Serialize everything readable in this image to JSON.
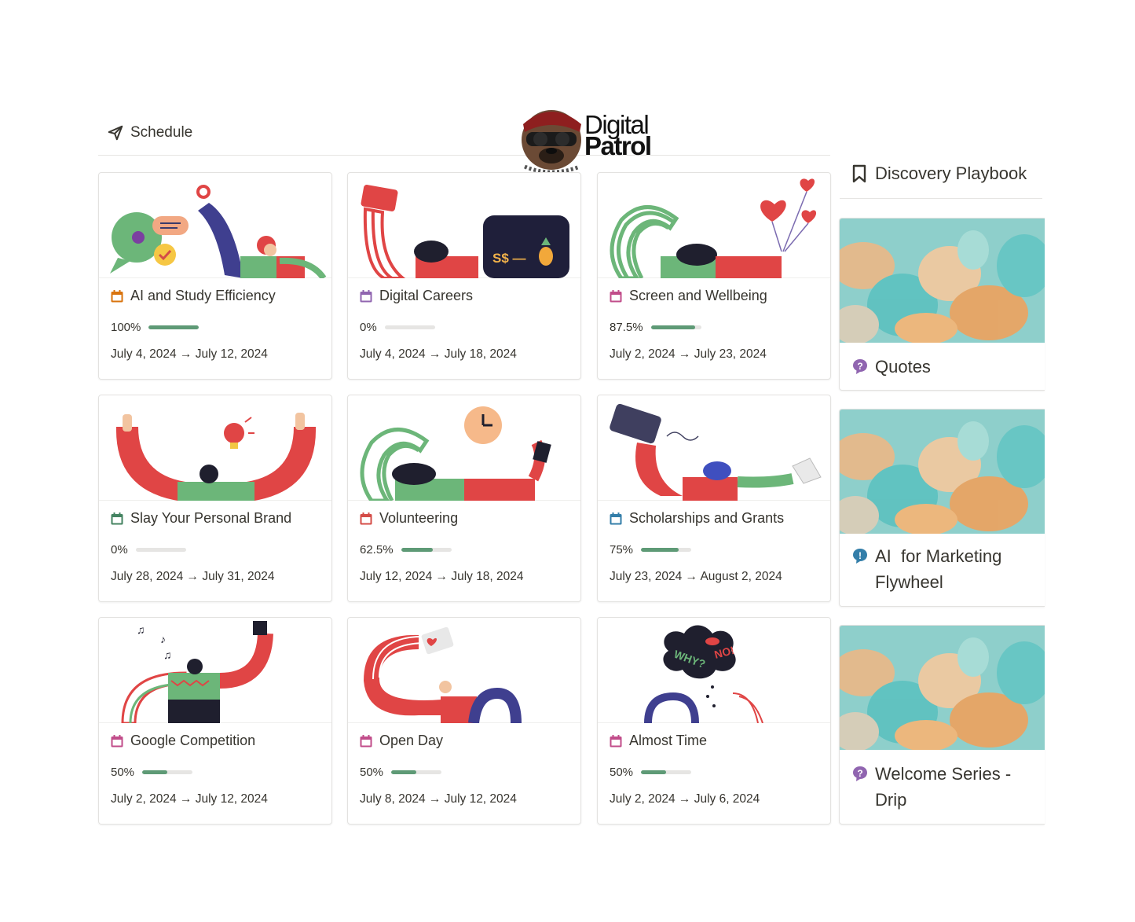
{
  "schedule": {
    "title": "Schedule"
  },
  "logo": {
    "line1": "Digital",
    "line2": "Patrol"
  },
  "cards": [
    {
      "title": "AI and Study Efficiency",
      "icon_color": "#d9730d",
      "progress_label": "100%",
      "progress": 1.0,
      "dates": "July 4, 2024 → July 12, 2024"
    },
    {
      "title": "Digital Careers",
      "icon_color": "#9065b0",
      "progress_label": "0%",
      "progress": 0.0,
      "dates": "July 4, 2024 → July 18, 2024"
    },
    {
      "title": "Screen and Wellbeing",
      "icon_color": "#c14c8a",
      "progress_label": "87.5%",
      "progress": 0.875,
      "dates": "July 2, 2024 → July 23, 2024"
    },
    {
      "title": "Slay Your Personal Brand",
      "icon_color": "#448361",
      "progress_label": "0%",
      "progress": 0.0,
      "dates": "July 28, 2024 → July 31, 2024"
    },
    {
      "title": "Volunteering",
      "icon_color": "#d44c47",
      "progress_label": "62.5%",
      "progress": 0.625,
      "dates": "July 12, 2024 → July 18, 2024"
    },
    {
      "title": "Scholarships and Grants",
      "icon_color": "#337ea9",
      "progress_label": "75%",
      "progress": 0.75,
      "dates": "July 23, 2024 → August 2, 2024"
    },
    {
      "title": "Google Competition",
      "icon_color": "#c14c8a",
      "progress_label": "50%",
      "progress": 0.5,
      "dates": "July 2, 2024 → July 12, 2024"
    },
    {
      "title": "Open Day",
      "icon_color": "#c14c8a",
      "progress_label": "50%",
      "progress": 0.5,
      "dates": "July 8, 2024 → July 12, 2024"
    },
    {
      "title": "Almost Time",
      "icon_color": "#c14c8a",
      "progress_label": "50%",
      "progress": 0.5,
      "dates": "July 2, 2024 → July 6, 2024"
    }
  ],
  "discovery": {
    "title": "Discovery Playbook",
    "items": [
      {
        "line1": "Quotes",
        "line2": "",
        "icon": "question-bubble-icon",
        "icon_color": "#9065b0"
      },
      {
        "line1": "AI  for Marketing",
        "line2": "Flywheel",
        "icon": "exclamation-bubble-icon",
        "icon_color": "#337ea9"
      },
      {
        "line1": "Welcome Series -",
        "line2": "Drip",
        "icon": "question-bubble-icon",
        "icon_color": "#9065b0"
      }
    ]
  }
}
